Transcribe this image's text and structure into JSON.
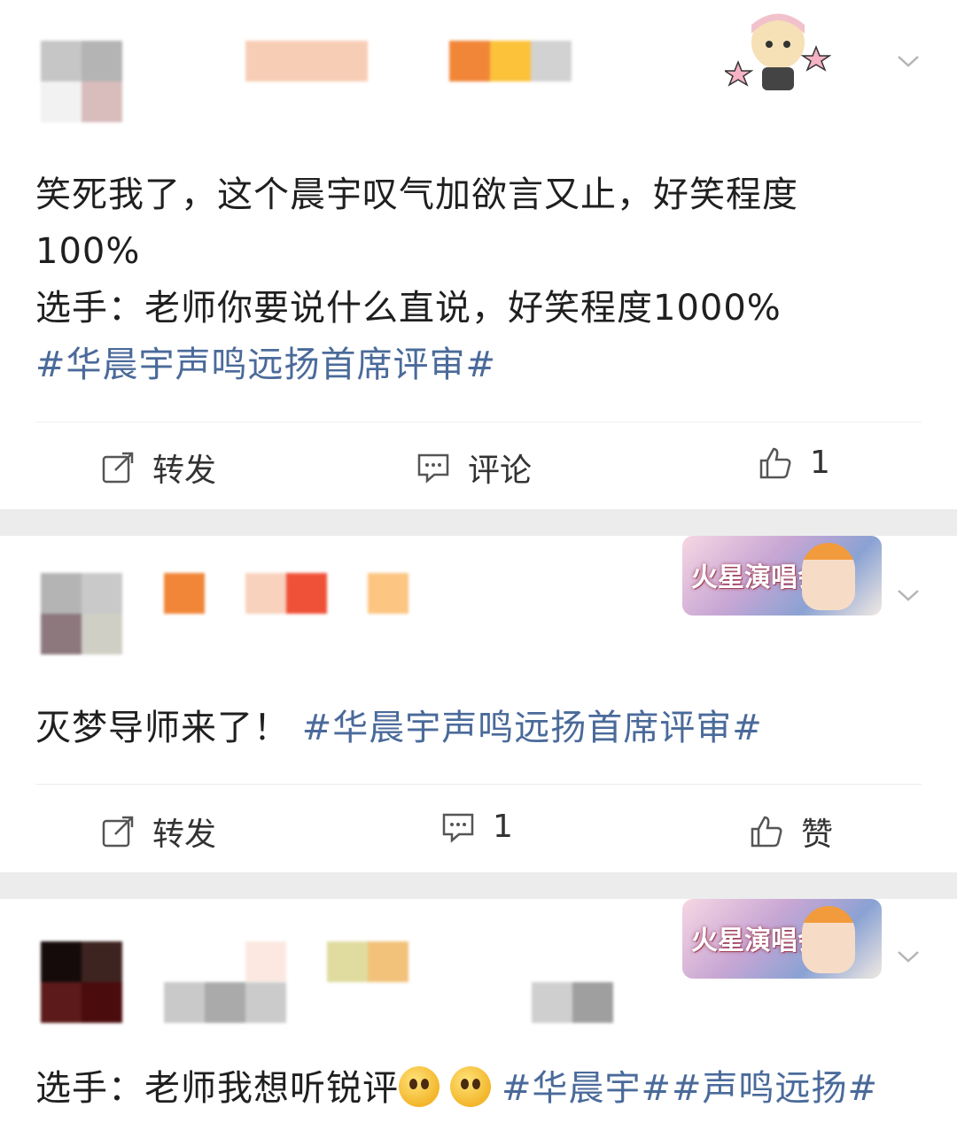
{
  "posts": [
    {
      "text_lines": [
        "笑死我了，这个晨宇叹气加欲言又止，好笑程度",
        "100%",
        "选手：老师你要说什么直说，好笑程度1000%"
      ],
      "hashtag": "#华晨宇声鸣远扬首席评审#",
      "actions": {
        "repost": "转发",
        "comment": "评论",
        "like": "1"
      }
    },
    {
      "text": "灭梦导师来了！",
      "hashtag": "#华晨宇声鸣远扬首席评审#",
      "badge": "火星演唱会",
      "actions": {
        "repost": "转发",
        "comment": "1",
        "like": "赞"
      }
    },
    {
      "text": "选手：老师我想听锐评",
      "hashtags": "#华晨宇##声鸣远扬#",
      "badge": "火星演唱会"
    }
  ],
  "icons": [
    "chevron-down-icon",
    "repost-icon",
    "comment-icon",
    "thumbs-up-icon",
    "pleading-face-emoji"
  ],
  "colors": {
    "hashtag": "#4a6a9a",
    "separator": "#ececec",
    "text": "#1f1f1f"
  }
}
